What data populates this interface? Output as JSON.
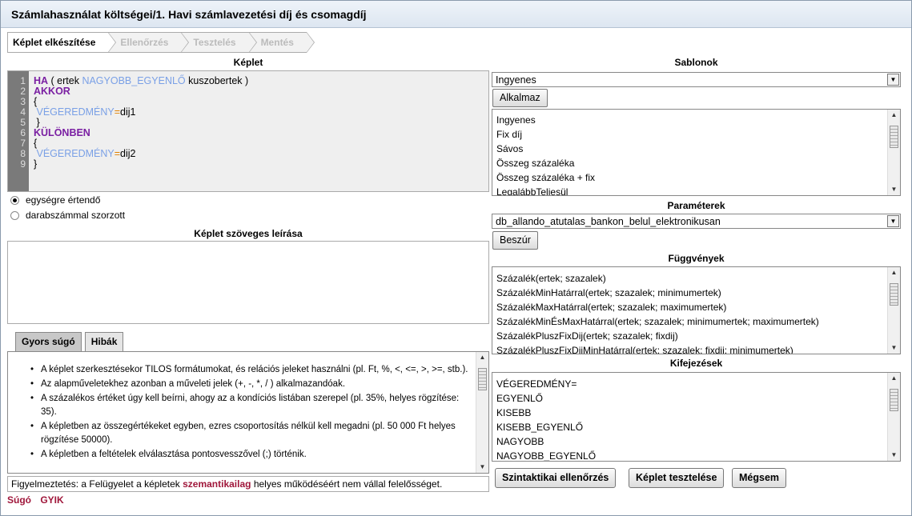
{
  "window": {
    "title": "Számlahasználat költségei/1. Havi számlavezetési díj és csomagdíj"
  },
  "wizard": {
    "steps": [
      "Képlet elkészítése",
      "Ellenőrzés",
      "Tesztelés",
      "Mentés"
    ],
    "active_index": 0
  },
  "formula": {
    "header": "Képlet",
    "line_numbers": [
      "1",
      "2",
      "3",
      "4",
      "5",
      "6",
      "7",
      "8",
      "9"
    ],
    "lines": [
      [
        "kw:HA",
        "t: ( ertek ",
        "id:NAGYOBB_EGYENLŐ",
        "t: kuszobertek )"
      ],
      [
        "kw:AKKOR"
      ],
      [
        "t:{"
      ],
      [
        "t: ",
        "id:VÉGEREDMÉNY",
        "op:=",
        "t:dij1"
      ],
      [
        "t: }"
      ],
      [
        "kw:KÜLÖNBEN"
      ],
      [
        "t:{"
      ],
      [
        "t: ",
        "id:VÉGEREDMÉNY",
        "op:=",
        "t:dij2"
      ],
      [
        "t:}"
      ]
    ]
  },
  "options": {
    "per_unit_label": "egységre értendő",
    "multiplied_label": "darabszámmal szorzott",
    "selected": "per_unit"
  },
  "description": {
    "header": "Képlet szöveges leírása",
    "value": ""
  },
  "help_tabs": {
    "quick_help": "Gyors súgó",
    "errors": "Hibák",
    "active": "quick_help"
  },
  "help_items": [
    "A képlet szerkesztésekor TILOS formátumokat, és relációs jeleket használni (pl. Ft, %, <, <=, >, >=, stb.).",
    "Az alapműveletekhez azonban a műveleti jelek (+, -, *, / ) alkalmazandóak.",
    "A százalékos értéket úgy kell beírni, ahogy az a kondíciós listában szerepel (pl. 35%, helyes rögzítése: 35).",
    "A képletben az összegértékeket egyben, ezres csoportosítás nélkül kell megadni (pl. 50 000 Ft helyes rögzítése 50000).",
    "A képletben a feltételek elválasztása pontosvesszővel (;) történik."
  ],
  "warning": {
    "prefix": "Figyelmeztetés: a Felügyelet a képletek ",
    "emphasis": "szemantikailag",
    "suffix": " helyes működéséért nem vállal felelősséget."
  },
  "footer_links": {
    "help": "Súgó",
    "faq": "GYIK"
  },
  "templates": {
    "header": "Sablonok",
    "selected": "Ingyenes",
    "apply_label": "Alkalmaz",
    "items": [
      "Ingyenes",
      "Fix díj",
      "Sávos",
      "Összeg százaléka",
      "Összeg százaléka + fix",
      "LegalábbTeljesül"
    ]
  },
  "parameters": {
    "header": "Paraméterek",
    "selected": "db_allando_atutalas_bankon_belul_elektronikusan",
    "insert_label": "Beszúr"
  },
  "functions": {
    "header": "Függvények",
    "items": [
      "Százalék(ertek; szazalek)",
      "SzázalékMinHatárral(ertek; szazalek; minimumertek)",
      "SzázalékMaxHatárral(ertek; szazalek; maximumertek)",
      "SzázalékMinÉsMaxHatárral(ertek; szazalek; minimumertek; maximumertek)",
      "SzázalékPluszFixDij(ertek; szazalek; fixdij)",
      "SzázalékPluszFixDijMinHatárral(ertek; szazalek; fixdij; minimumertek)"
    ]
  },
  "expressions": {
    "header": "Kifejezések",
    "items": [
      "VÉGEREDMÉNY=",
      "EGYENLŐ",
      "KISEBB",
      "KISEBB_EGYENLŐ",
      "NAGYOBB",
      "NAGYOBB_EGYENLŐ"
    ]
  },
  "actions": {
    "syntax_check": "Szintaktikai ellenőrzés",
    "test_formula": "Képlet tesztelése",
    "cancel": "Mégsem"
  },
  "icons": {
    "dropdown": "chevron-down-icon",
    "scroll_up": "arrow-up-icon",
    "scroll_down": "arrow-down-icon"
  },
  "colors": {
    "keyword": "#7a1fa2",
    "identifier": "#7aa0e6",
    "operator": "#e08000",
    "link": "#a0173b"
  }
}
